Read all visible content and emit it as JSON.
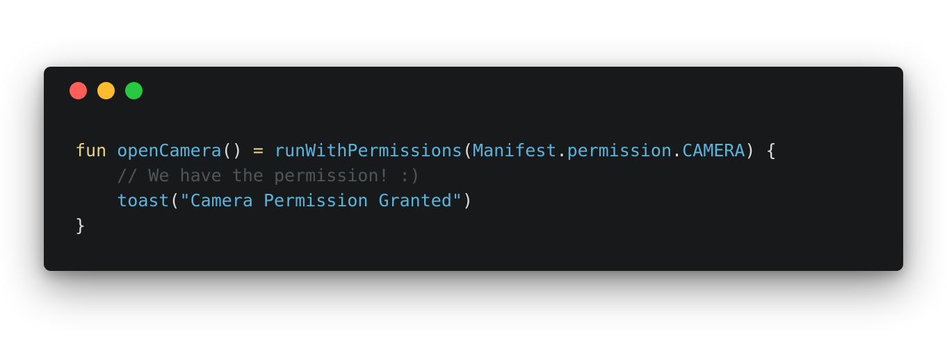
{
  "window": {
    "controls": [
      {
        "name": "close",
        "color": "#ff5f57"
      },
      {
        "name": "minimize",
        "color": "#febc2e"
      },
      {
        "name": "zoom",
        "color": "#28c840"
      }
    ]
  },
  "colors": {
    "keyword": "#e5d48a",
    "function": "#5ab4dc",
    "type": "#5ab4dc",
    "punctuation": "#dcdcdc",
    "operator": "#e5d48a",
    "comment": "#4f5558",
    "string": "#5ab4dc"
  },
  "code": {
    "line1": {
      "keyword": "fun",
      "space1": " ",
      "fn_name": "openCamera",
      "parens": "()",
      "space2": " ",
      "equals": "=",
      "space3": " ",
      "call": "runWithPermissions",
      "open_paren": "(",
      "manifest": "Manifest",
      "dot1": ".",
      "permission": "permission",
      "dot2": ".",
      "camera": "CAMERA",
      "close_paren": ")",
      "space4": " ",
      "open_brace": "{"
    },
    "line2": {
      "indent": "    ",
      "comment": "// We have the permission! :)"
    },
    "line3": {
      "indent": "    ",
      "fn": "toast",
      "open_paren": "(",
      "string": "\"Camera Permission Granted\"",
      "close_paren": ")"
    },
    "line4": {
      "close_brace": "}"
    }
  }
}
